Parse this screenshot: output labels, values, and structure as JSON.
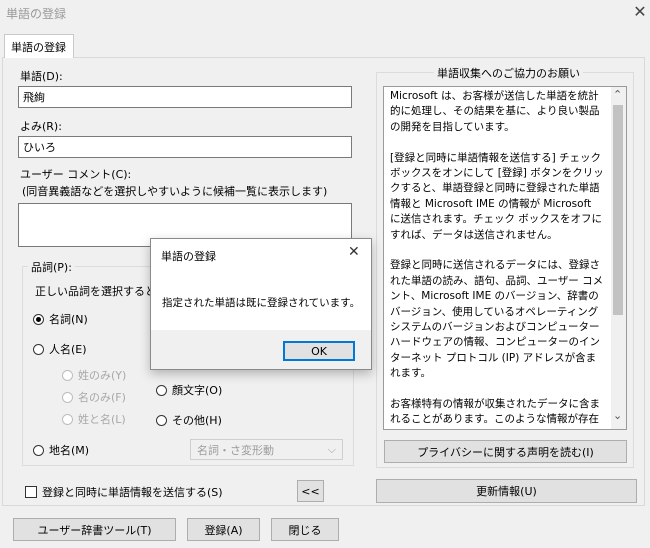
{
  "window": {
    "title": "単語の登録",
    "close_symbol": "✕"
  },
  "tab": {
    "label": "単語の登録"
  },
  "form": {
    "word_label": "単語(D):",
    "word_value": "飛絢",
    "reading_label": "よみ(R):",
    "reading_value": "ひいろ",
    "comment_label": "ユーザー コメント(C):",
    "comment_hint": "(同音異義語などを選択しやすいように候補一覧に表示します)",
    "comment_value": ""
  },
  "pos": {
    "group_label": "品詞(P):",
    "instruction": "正しい品詞を選択すると",
    "options": {
      "noun": "名詞(N)",
      "person": "人名(E)",
      "surname": "姓のみ(Y)",
      "given": "名のみ(F)",
      "fullname": "姓と名(L)",
      "place": "地名(M)",
      "emoticon": "顔文字(O)",
      "other": "その他(H)"
    },
    "selected": "noun",
    "subtype_select": "名詞・さ変形動",
    "dropdown_arrow": "⌵"
  },
  "send_checkbox": {
    "label": "登録と同時に単語情報を送信する(S)",
    "checked": false
  },
  "collapse_button": "<<",
  "info": {
    "group_label": "単語収集へのご協力のお願い",
    "paragraphs": [
      "Microsoft は、お客様が送信した単語を統計的に処理し、その結果を基に、より良い製品の開発を目指しています。",
      "[登録と同時に単語情報を送信する] チェック ボックスをオンにして [登録] ボタンをクリックすると、単語登録と同時に登録された単語情報と Microsoft IME の情報が Microsoft に送信されます。チェック ボックスをオフにすれば、データは送信されません。",
      "登録と同時に送信されるデータには、登録された単語の読み、語句、品詞、ユーザー コメント、Microsoft IME のバージョン、辞書のバージョン、使用しているオペレーティング システムのバージョンおよびコンピューター ハードウェアの情報、コンピューターのインターネット プロトコル (IP) アドレスが含まれます。",
      "お客様特有の情報が収集されたデータに含まれることがあります。このような情報が存在する場合でも、Microsoft では、お客様を特定するために使用することはありません。"
    ],
    "scroll_up": "⌃",
    "scroll_down": "⌄",
    "privacy_button": "プライバシーに関する声明を読む(I)",
    "update_button": "更新情報(U)"
  },
  "footer": {
    "dictionary_tool": "ユーザー辞書ツール(T)",
    "register": "登録(A)",
    "close": "閉じる"
  },
  "dialog": {
    "title": "単語の登録",
    "close_symbol": "✕",
    "message": "指定された単語は既に登録されています。",
    "ok": "OK"
  }
}
